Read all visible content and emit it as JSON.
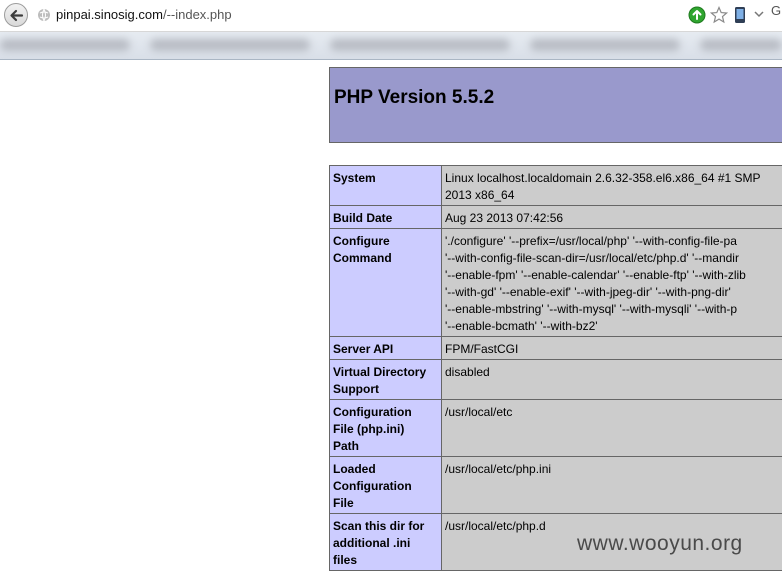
{
  "browser": {
    "url_host": "pinpai.sinosig.com",
    "url_path": "/--index.php"
  },
  "page": {
    "title": "PHP Version 5.5.2"
  },
  "info_table": [
    {
      "key": "System",
      "value": "Linux localhost.localdomain 2.6.32-358.el6.x86_64 #1 SMP\n2013 x86_64"
    },
    {
      "key": "Build Date",
      "value": "Aug 23 2013 07:42:56"
    },
    {
      "key": "Configure\nCommand",
      "value": "'./configure' '--prefix=/usr/local/php' '--with-config-file-pa\n'--with-config-file-scan-dir=/usr/local/etc/php.d' '--mandir\n'--enable-fpm' '--enable-calendar' '--enable-ftp' '--with-zlib\n'--with-gd' '--enable-exif' '--with-jpeg-dir' '--with-png-dir'\n'--enable-mbstring' '--with-mysql' '--with-mysqli' '--with-p\n'--enable-bcmath' '--with-bz2'"
    },
    {
      "key": "Server API",
      "value": "FPM/FastCGI"
    },
    {
      "key": "Virtual Directory\nSupport",
      "value": "disabled"
    },
    {
      "key": "Configuration\nFile (php.ini)\nPath",
      "value": "/usr/local/etc"
    },
    {
      "key": "Loaded\nConfiguration\nFile",
      "value": "/usr/local/etc/php.ini"
    },
    {
      "key": "Scan this dir for\nadditional .ini\nfiles",
      "value": "/usr/local/etc/php.d"
    }
  ],
  "watermark": "www.wooyun.org"
}
